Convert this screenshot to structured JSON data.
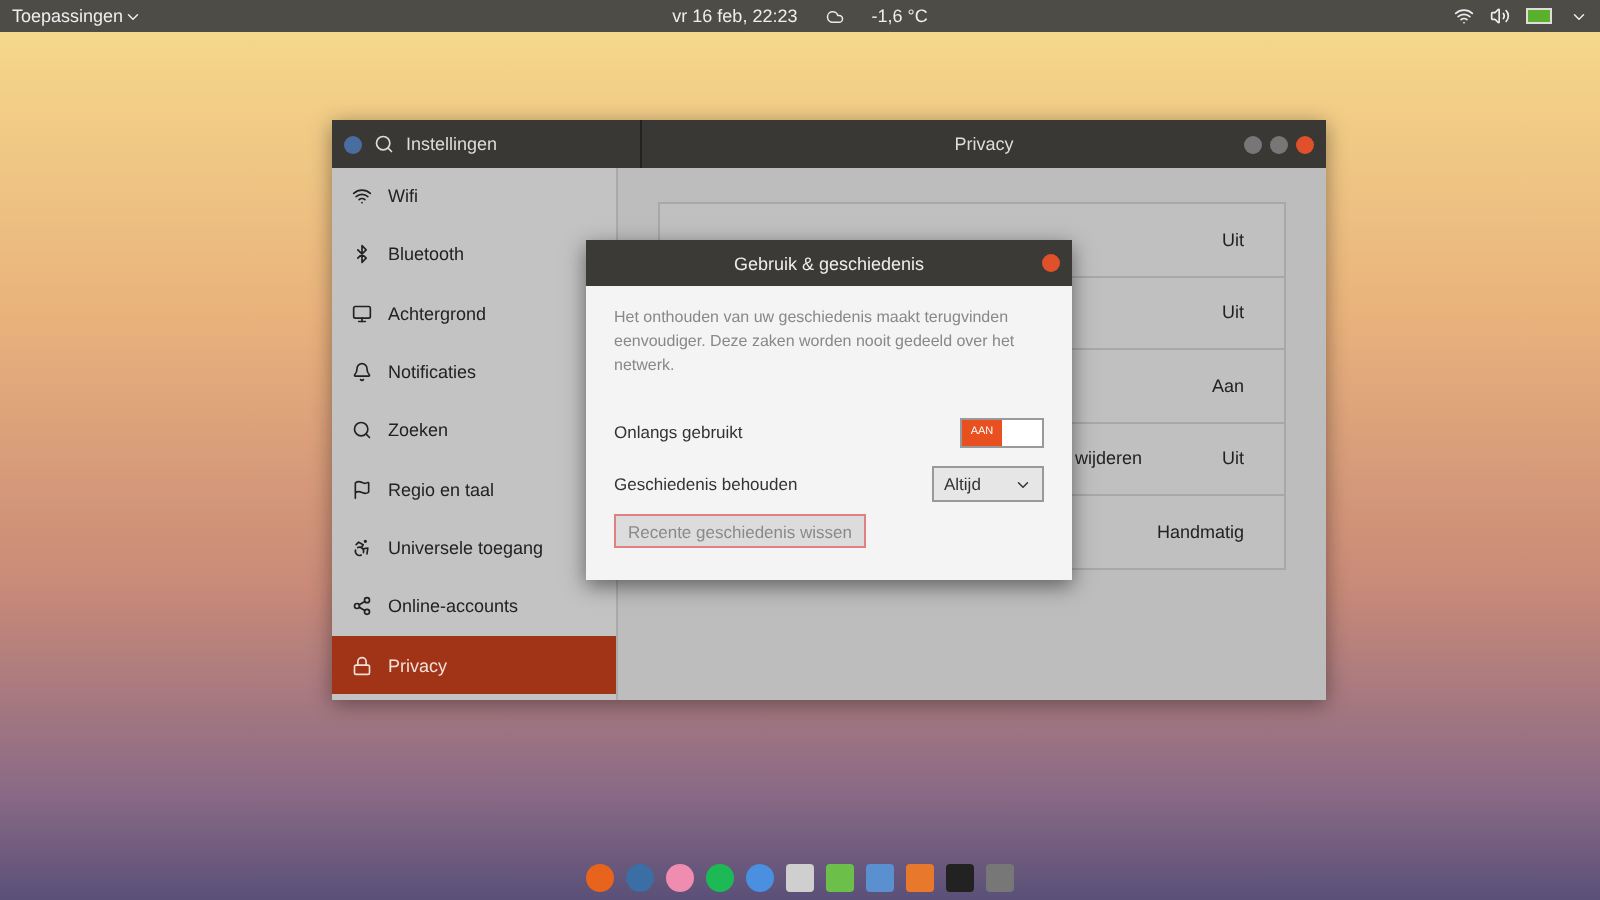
{
  "top_bar": {
    "apps_menu": "Toepassingen",
    "clock": "vr 16 feb, 22:23",
    "weather": "-1,6 °C"
  },
  "window": {
    "sidebar_title": "Instellingen",
    "title": "Privacy"
  },
  "sidebar": {
    "items": [
      {
        "label": "Wifi",
        "selected": false
      },
      {
        "label": "Bluetooth",
        "selected": false
      },
      {
        "label": "Achtergrond",
        "selected": false
      },
      {
        "label": "Notificaties",
        "selected": false
      },
      {
        "label": "Zoeken",
        "selected": false
      },
      {
        "label": "Regio en taal",
        "selected": false
      },
      {
        "label": "Universele toegang",
        "selected": false
      },
      {
        "label": "Online-accounts",
        "selected": false
      },
      {
        "label": "Privacy",
        "selected": true
      }
    ]
  },
  "privacy_rows": [
    {
      "value": "Uit"
    },
    {
      "value": "Uit"
    },
    {
      "value": "Aan"
    },
    {
      "label": "wijderen",
      "value": "Uit"
    },
    {
      "value": "Handmatig"
    }
  ],
  "dialog": {
    "title": "Gebruik & geschiedenis",
    "description": "Het onthouden van uw geschiedenis maakt terugvinden eenvoudiger. Deze zaken worden nooit gedeeld over het netwerk.",
    "recent_label": "Onlangs gebruikt",
    "recent_switch": {
      "on": true,
      "text": "AAN"
    },
    "retention_label": "Geschiedenis behouden",
    "retention_value": "Altijd",
    "clear_button": {
      "label": "Recente geschiedenis wissen",
      "disabled": true
    }
  },
  "dock": {
    "apps": [
      {
        "color": "#e8641c"
      },
      {
        "color": "#3a6ea5"
      },
      {
        "color": "#f08cb0"
      },
      {
        "color": "#1db954"
      },
      {
        "color": "#4a8fe0"
      },
      {
        "color": "#cfcfcf"
      },
      {
        "color": "#6cc04a"
      },
      {
        "color": "#5a8fd0"
      },
      {
        "color": "#e8792c"
      },
      {
        "color": "#222222"
      },
      {
        "color": "#777777"
      }
    ]
  }
}
